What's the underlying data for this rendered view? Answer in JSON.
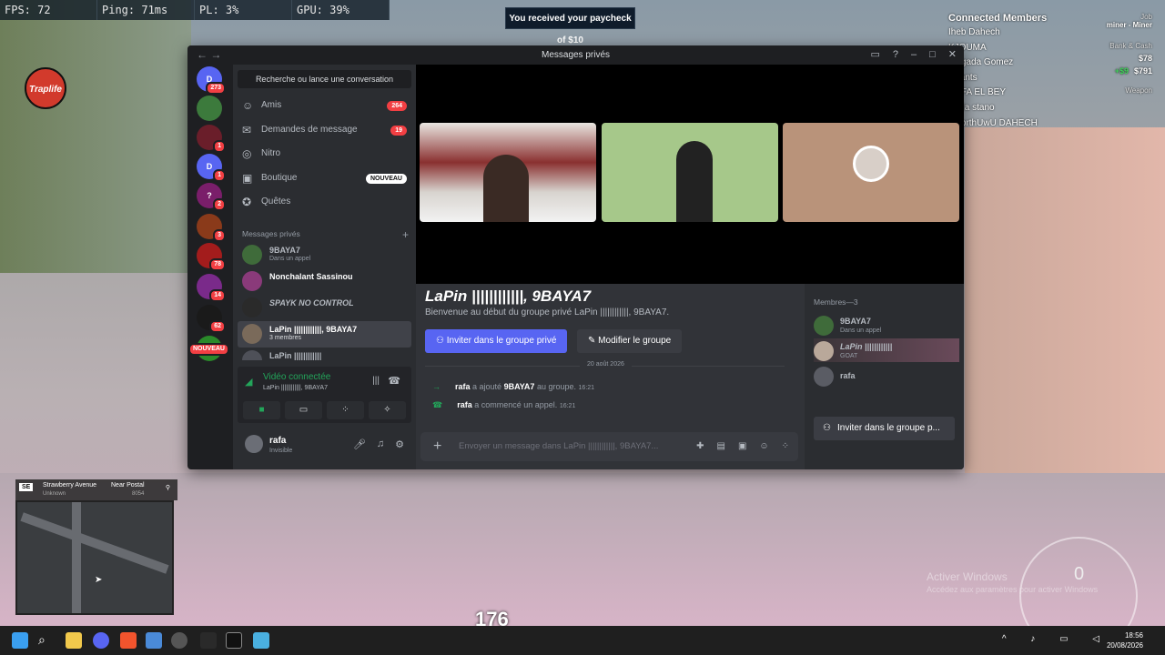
{
  "hud": {
    "fps": "FPS: 72",
    "ping": "Ping: 71ms",
    "pl": "PL: 3%",
    "gpu": "GPU: 39%",
    "paycheck": "You received your paycheck of $10",
    "logo": "Traplife"
  },
  "members_overlay": {
    "title": "Connected Members",
    "names": [
      "Iheb Dahech",
      "KJOUMA",
      "Magada Gomez",
      "Lwants",
      "RAFA EL BEY",
      "stella stano",
      "XNorthUwU DAHECH"
    ]
  },
  "job": {
    "label": "Job",
    "value": "miner - Miner",
    "bank_label": "Bank & Cash",
    "bank": "$78",
    "cash": "$791",
    "delta": "+$9",
    "weapon": "Weapon"
  },
  "window": {
    "title": "Messages privés"
  },
  "servers": [
    {
      "label": "D",
      "badge": "273",
      "color": "#5865f2"
    },
    {
      "label": "",
      "badge": "",
      "color": "#3c7a3c"
    },
    {
      "label": "",
      "badge": "1",
      "color": "#6a1e2a"
    },
    {
      "label": "D",
      "badge": "1",
      "color": "#5865f2"
    },
    {
      "label": "?",
      "badge": "2",
      "color": "#7a1e6a"
    },
    {
      "label": "",
      "badge": "3",
      "color": "#8a3a1a"
    },
    {
      "label": "",
      "badge": "78",
      "color": "#a31c1c"
    },
    {
      "label": "",
      "badge": "14",
      "color": "#7a2a8a"
    },
    {
      "label": "",
      "badge": "62",
      "color": "#1a1a1a"
    },
    {
      "label": "",
      "badge": "NOUVEAU",
      "color": "#2a8a2a"
    }
  ],
  "channels": {
    "search": "Recherche ou lance une conversation",
    "nav": [
      {
        "label": "Amis",
        "badge": "264"
      },
      {
        "label": "Demandes de message",
        "badge": "19"
      },
      {
        "label": "Nitro",
        "badge": ""
      },
      {
        "label": "Boutique",
        "badge": "NOUVEAU"
      },
      {
        "label": "Quêtes",
        "badge": ""
      }
    ],
    "section": "Messages privés",
    "plus": "+",
    "dms": [
      {
        "name": "9BAYA7",
        "sub": "Dans un appel"
      },
      {
        "name": "Nonchalant Sassinou",
        "sub": ""
      },
      {
        "name": "SPAYK NO CONTROL",
        "sub": ""
      },
      {
        "name": "LaPin ||||||||||||, 9BAYA7",
        "sub": "3 membres"
      },
      {
        "name": "LaPin ||||||||||||",
        "sub": ""
      }
    ]
  },
  "voice": {
    "title": "Vidéo connectée",
    "sub": "LaPin ||||||||||||, 9BAYA7"
  },
  "user": {
    "name": "rafa",
    "status": "Invisible"
  },
  "main": {
    "group_title": "LaPin ||||||||||||, 9BAYA7",
    "welcome": "Bienvenue au début du groupe privé LaPin ||||||||||||, 9BAYA7.",
    "invite": "Inviter dans le groupe privé",
    "edit": "Modifier le groupe",
    "date": "20 août 2026",
    "msg1": {
      "user": "rafa",
      "text": "a ajouté",
      "target": "9BAYA7",
      "rest": "au groupe.",
      "time": "16:21"
    },
    "msg2": {
      "user": "rafa",
      "text": "a commencé un appel.",
      "time": "16:21"
    },
    "composer": "Envoyer un message dans LaPin ||||||||||||, 9BAYA7..."
  },
  "members": {
    "title": "Membres—3",
    "list": [
      {
        "name": "9BAYA7",
        "sub": "Dans un appel"
      },
      {
        "name": "LaPin ||||||||||||",
        "sub": "GOAT"
      },
      {
        "name": "rafa",
        "sub": ""
      }
    ],
    "invite": "Inviter dans le groupe p..."
  },
  "map": {
    "dir": "SE",
    "street": "Strawberry Avenue",
    "area": "Unknown",
    "zone": "Near Postal",
    "postal": "8054"
  },
  "vehicle": {
    "speed": "176",
    "gauge": "0"
  },
  "watermark": {
    "line1": "Activer Windows",
    "line2": "Accédez aux paramètres pour activer Windows"
  },
  "clock": {
    "time": "18:56",
    "date": "20/08/2026"
  }
}
